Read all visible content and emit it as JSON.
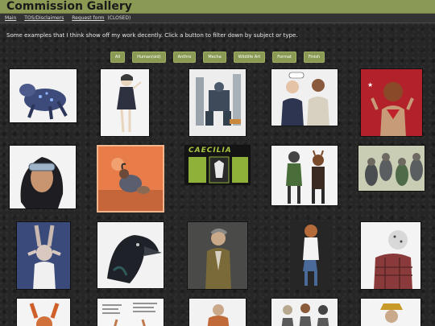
{
  "header": {
    "title": "Commission Gallery"
  },
  "nav": {
    "main": "Main",
    "tos": "TOS/Disclaimers",
    "request": "Request form",
    "request_status": "(CLOSED)"
  },
  "intro": "Some examples that I think show off my work decently. Click a button to filter down by subject or type.",
  "filters": [
    "All",
    "Human(oid)",
    "Anthro",
    "Mecha",
    "Wildlife Art",
    "Format",
    "Finish"
  ],
  "comic_text": "CAECILIA",
  "colors": {
    "accent": "#8a9a54",
    "background": "#262626",
    "navbar": "#333333"
  }
}
